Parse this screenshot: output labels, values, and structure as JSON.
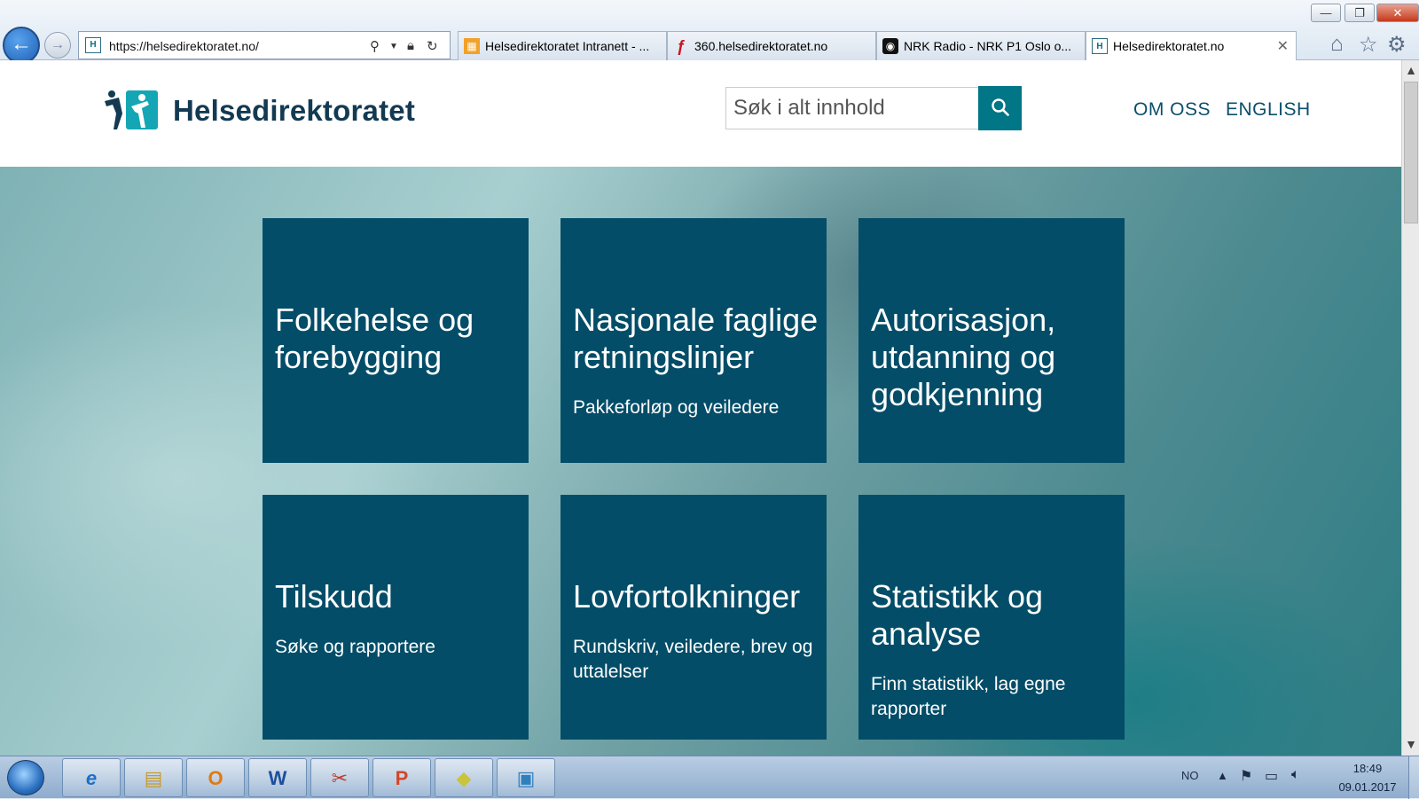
{
  "browser": {
    "url": "https://helsedirektoratet.no/",
    "window_buttons": {
      "minimize": "—",
      "restore": "❐",
      "close": "✕"
    },
    "tabs": [
      {
        "title": "Helsedirektoratet Intranett - ...",
        "icon": "intranet-icon",
        "active": false
      },
      {
        "title": "360.helsedirektoratet.no",
        "icon": "360-icon",
        "active": false
      },
      {
        "title": "NRK Radio - NRK P1 Oslo o...",
        "icon": "nrk-radio-icon",
        "active": false
      },
      {
        "title": "Helsedirektoratet.no",
        "icon": "helsedirektoratet-favicon",
        "active": true
      }
    ],
    "toolbar_icons": [
      "home-icon",
      "favorites-star-icon",
      "tools-gear-icon"
    ]
  },
  "site": {
    "logo_text": "Helsedirektoratet",
    "search_placeholder": "Søk i alt innhold",
    "nav_links": [
      "OM OSS",
      "ENGLISH"
    ],
    "accent_color": "#007686",
    "tile_color": "#034d68"
  },
  "tiles": [
    {
      "title": "Folkehelse og forebygging",
      "subtitle": ""
    },
    {
      "title": "Nasjonale faglige retningslinjer",
      "subtitle": "Pakkeforløp og veiledere"
    },
    {
      "title": "Autorisasjon, utdanning og godkjenning",
      "subtitle": ""
    },
    {
      "title": "Tilskudd",
      "subtitle": "Søke og rapportere"
    },
    {
      "title": "Lovfortolkninger",
      "subtitle": "Rundskriv, veiledere, brev og uttalelser"
    },
    {
      "title": "Statistikk og analyse",
      "subtitle": "Finn statistikk, lag egne rapporter"
    }
  ],
  "taskbar": {
    "apps": [
      {
        "name": "internet-explorer",
        "glyph": "e"
      },
      {
        "name": "file-explorer",
        "glyph": "▤"
      },
      {
        "name": "outlook",
        "glyph": "O"
      },
      {
        "name": "word",
        "glyph": "W"
      },
      {
        "name": "snipping-tool",
        "glyph": "✂"
      },
      {
        "name": "powerpoint",
        "glyph": "P"
      },
      {
        "name": "sticky-notes",
        "glyph": "◆"
      },
      {
        "name": "remote-desktop",
        "glyph": "▣"
      }
    ],
    "language": "NO",
    "time": "18:49",
    "date": "09.01.2017"
  }
}
